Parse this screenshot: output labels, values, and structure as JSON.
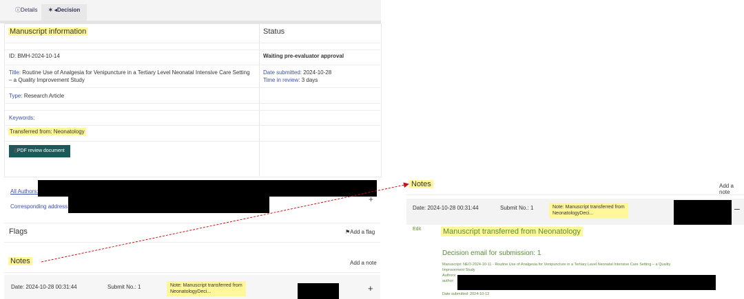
{
  "tabs": [
    {
      "label": "Details",
      "icon": "info-icon"
    },
    {
      "label": "Decision",
      "icon": "gavel-icon"
    }
  ],
  "manuscript": {
    "heading": "Manuscript information",
    "id_text": "ID: BMH-2024-10-14",
    "title_label": "Title:",
    "title_value": "Routine Use of Analgesia for Venipuncture in a Tertiary Level Neonatal Intensive Care Setting",
    "title_value_2": "– a Quality Improvement Study",
    "type_label": "Type:",
    "type_value": "Research Article",
    "keywords_label": "Keywords:",
    "transferred_text": "Transferred from: Neonatology",
    "pdf_button": "PDF review document",
    "all_authors": "All Authors:",
    "corresponding": "Corresponding address:"
  },
  "status": {
    "heading": "Status",
    "state": "Waiting pre-evaluator approval",
    "date_label": "Date submitted:",
    "date_value": "2024-10-28",
    "time_label": "Time in review:",
    "time_value": "3 days"
  },
  "flags": {
    "heading": "Flags",
    "add": "Add a flag"
  },
  "notes_left": {
    "heading": "Notes",
    "add": "Add a note",
    "date": "Date: 2024-10-28 00:31:44",
    "submit": "Submit No.: 1",
    "note_line1": "Note: Manuscript transferred from",
    "note_line2": "NeonatologyDeci...",
    "toggle": "+"
  },
  "notes_right": {
    "heading": "Notes",
    "add": "Add a note",
    "date": "Date: 2024-10-28 00:31:44",
    "submit": "Submit No.: 1",
    "note_line1": "Note: Manuscript transferred from",
    "note_line2": "NeonatologyDeci...",
    "toggle": "–",
    "edit": "Edit",
    "title": "Manuscript transferred from Neonatology",
    "decision_heading": "Decision email for submission: 1",
    "manuscript_line": "Manuscript: NEO-2024-10-11 - Routine Use of Analgesia for Venipuncture in a Tertiary Level Neonatal Intensive Care Setting – a Quality",
    "manuscript_line_2": "Improvement Study",
    "authors_label": "Authors:",
    "author_label": "author:",
    "date_submitted": "Date submitted: 2024-10-12"
  },
  "colors": {
    "highlight": "#fff79a",
    "arrow": "#cc1111",
    "button": "#1c5a5a"
  }
}
